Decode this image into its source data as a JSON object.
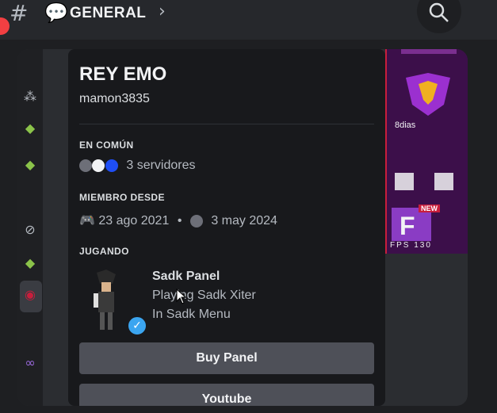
{
  "header": {
    "channel_name": "GENERAL"
  },
  "profile": {
    "display_name": "REY EMO",
    "username": "mamon3835",
    "in_common": {
      "heading": "EN COMÚN",
      "servers_text": "3 servidores"
    },
    "member_since": {
      "heading": "MIEMBRO DESDE",
      "discord_date": "23 ago 2021",
      "separator": "•",
      "server_date": "3 may 2024"
    },
    "playing": {
      "heading": "JUGANDO",
      "title": "Sadk Panel",
      "detail": "Playing Sadk Xiter",
      "state": "In Sadk Menu"
    },
    "buttons": [
      {
        "label": "Buy Panel"
      },
      {
        "label": "Youtube"
      }
    ]
  },
  "banner": {
    "days_text": "8dias",
    "new_tag": "NEW",
    "fps_text": "FPS 130"
  },
  "colors": {
    "background": "#1e1f22",
    "card": "#18191c",
    "button": "#4e5058",
    "badge": "#3ba5f0",
    "notification": "#f23f42",
    "banner": "#3c0f4a"
  },
  "icons": [
    "hashtag-icon",
    "speech-bubble-icon",
    "chevron-right-icon",
    "search-icon",
    "discord-icon",
    "server-icon",
    "verified-check-icon",
    "cursor-icon"
  ]
}
